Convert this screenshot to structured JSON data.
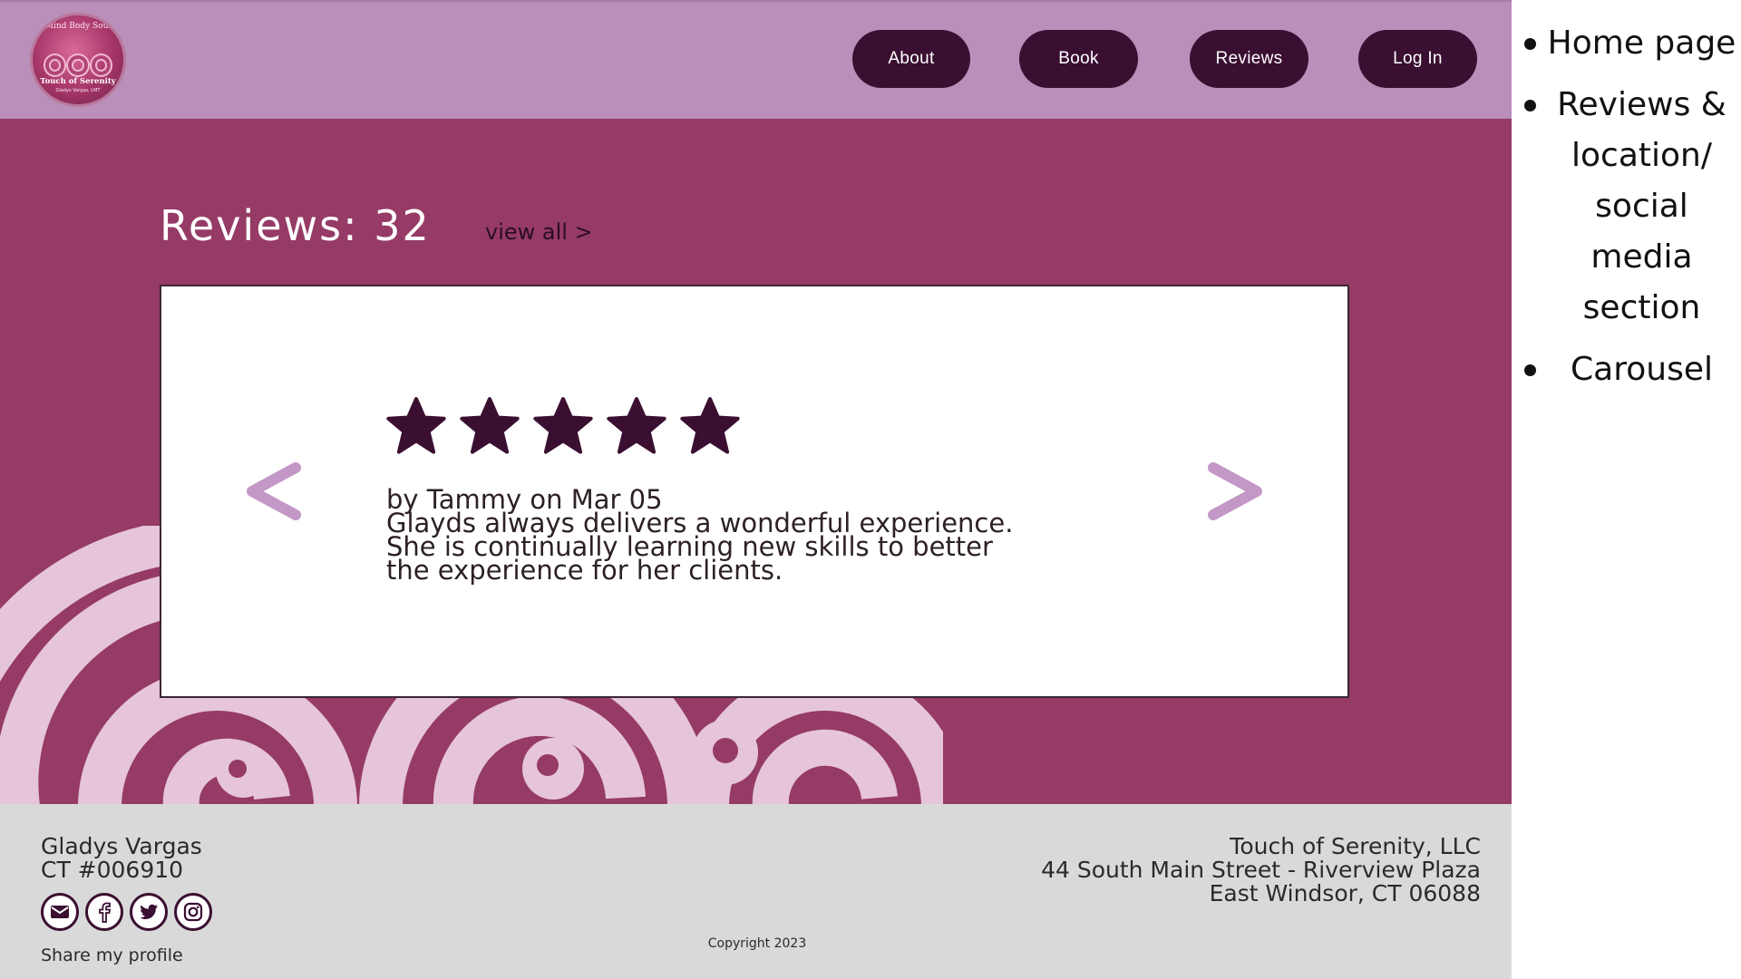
{
  "header": {
    "logo": {
      "top_text": "Mind Body Soul",
      "name": "Touch of Serenity",
      "sub": "Gladys Vargas, LMT"
    },
    "nav": [
      {
        "label": "About"
      },
      {
        "label": "Book"
      },
      {
        "label": "Reviews"
      },
      {
        "label": "Log In"
      }
    ]
  },
  "reviews": {
    "title": "Reviews: 32",
    "view_all": "view all >",
    "card": {
      "rating": 5,
      "meta": "by Tammy on Mar 05",
      "body_lines": [
        "Glayds always delivers a wonderful experience.",
        "She is continually learning new skills to better",
        "the experience for her clients."
      ]
    }
  },
  "footer": {
    "name": "Gladys Vargas",
    "license": "CT #006910",
    "socials": [
      "mail-icon",
      "facebook-icon",
      "twitter-icon",
      "instagram-icon"
    ],
    "share_label": "Share my profile",
    "copyright": "Copyright 2023",
    "business": {
      "name": "Touch of Serenity, LLC",
      "street": "44 South Main Street - Riverview Plaza",
      "city": "East Windsor, CT 06088"
    }
  },
  "notes": [
    "Home page",
    "Reviews & location/ social media section",
    "Carousel"
  ],
  "colors": {
    "header_bg": "#ba8fba",
    "main_bg": "#953b66",
    "button_bg": "#3a0f31",
    "arrow": "#c397c6",
    "star": "#3a0f31",
    "spiral": "#e6c5d8",
    "footer_bg": "#d9d9d9"
  }
}
